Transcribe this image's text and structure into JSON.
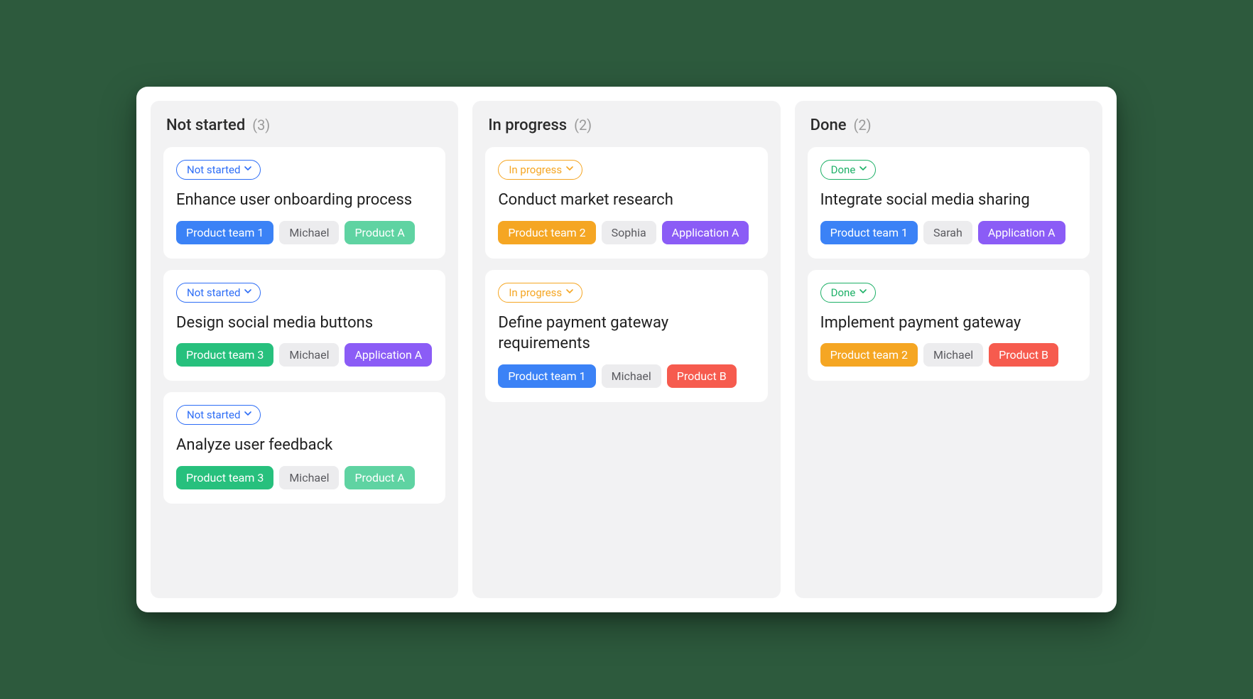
{
  "columns": [
    {
      "title": "Not started",
      "count": "(3)",
      "status_class": "not-started",
      "cards": [
        {
          "status": "Not started",
          "title": "Enhance user onboarding process",
          "tags": [
            {
              "label": "Product team 1",
              "color": "blue"
            },
            {
              "label": "Michael",
              "color": "gray"
            },
            {
              "label": "Product A",
              "color": "mint"
            }
          ]
        },
        {
          "status": "Not started",
          "title": "Design social media buttons",
          "tags": [
            {
              "label": "Product team 3",
              "color": "green"
            },
            {
              "label": "Michael",
              "color": "gray"
            },
            {
              "label": "Application A",
              "color": "purple"
            }
          ]
        },
        {
          "status": "Not started",
          "title": "Analyze user feedback",
          "tags": [
            {
              "label": "Product team 3",
              "color": "green"
            },
            {
              "label": "Michael",
              "color": "gray"
            },
            {
              "label": "Product A",
              "color": "mint"
            }
          ]
        }
      ]
    },
    {
      "title": "In progress",
      "count": "(2)",
      "status_class": "in-progress",
      "cards": [
        {
          "status": "In progress",
          "title": "Conduct market research",
          "tags": [
            {
              "label": "Product team 2",
              "color": "amber"
            },
            {
              "label": "Sophia",
              "color": "gray"
            },
            {
              "label": "Application A",
              "color": "purple"
            }
          ]
        },
        {
          "status": "In progress",
          "title": "Define payment gateway requirements",
          "tags": [
            {
              "label": "Product team 1",
              "color": "blue"
            },
            {
              "label": "Michael",
              "color": "gray"
            },
            {
              "label": "Product B",
              "color": "red"
            }
          ]
        }
      ]
    },
    {
      "title": "Done",
      "count": "(2)",
      "status_class": "done",
      "cards": [
        {
          "status": "Done",
          "title": "Integrate social media sharing",
          "tags": [
            {
              "label": "Product team 1",
              "color": "blue"
            },
            {
              "label": "Sarah",
              "color": "gray"
            },
            {
              "label": "Application A",
              "color": "purple"
            }
          ]
        },
        {
          "status": "Done",
          "title": "Implement payment gateway",
          "tags": [
            {
              "label": "Product team 2",
              "color": "amber"
            },
            {
              "label": "Michael",
              "color": "gray"
            },
            {
              "label": "Product B",
              "color": "red"
            }
          ]
        }
      ]
    }
  ]
}
